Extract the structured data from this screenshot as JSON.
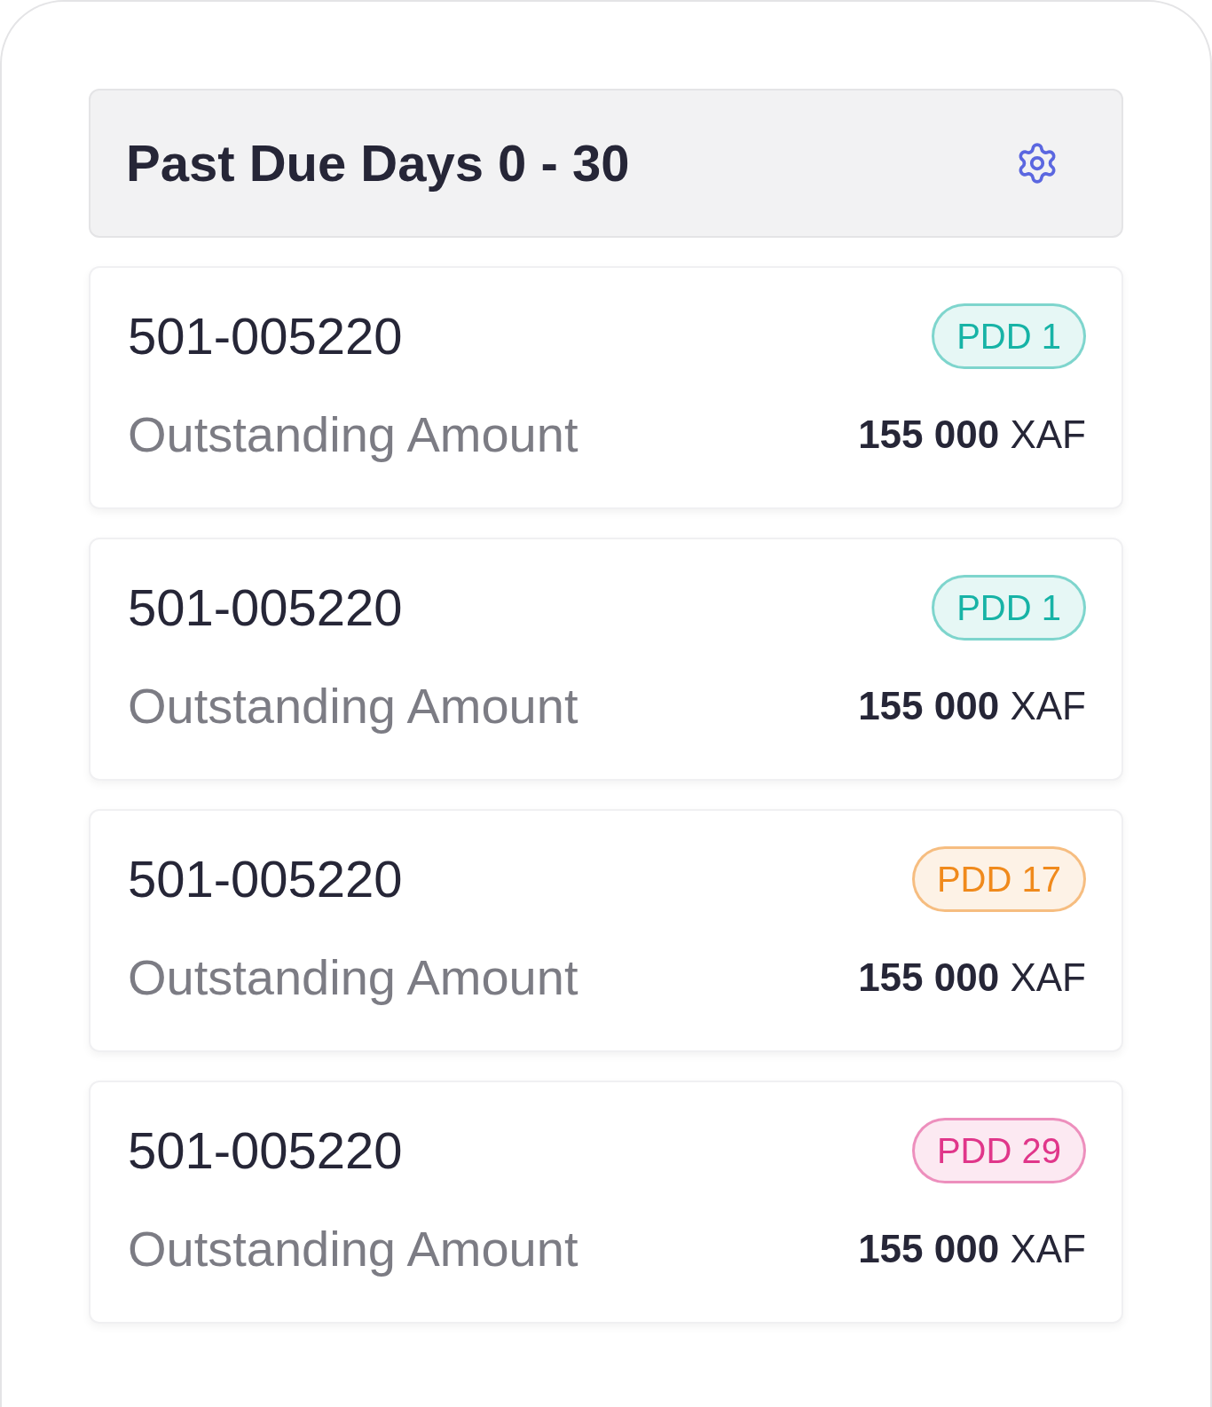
{
  "header": {
    "title": "Past Due Days 0 - 30"
  },
  "cards": [
    {
      "account": "501-005220",
      "badge": {
        "label": "PDD 1",
        "color": "#17b3a6"
      },
      "amount_label": "Outstanding Amount",
      "amount": "155 000",
      "currency": "XAF"
    },
    {
      "account": "501-005220",
      "badge": {
        "label": "PDD 1",
        "color": "#17b3a6"
      },
      "amount_label": "Outstanding Amount",
      "amount": "155 000",
      "currency": "XAF"
    },
    {
      "account": "501-005220",
      "badge": {
        "label": "PDD 17",
        "color": "#f08a1c"
      },
      "amount_label": "Outstanding Amount",
      "amount": "155 000",
      "currency": "XAF"
    },
    {
      "account": "501-005220",
      "badge": {
        "label": "PDD 29",
        "color": "#e0368a"
      },
      "amount_label": "Outstanding Amount",
      "amount": "155 000",
      "currency": "XAF"
    }
  ]
}
